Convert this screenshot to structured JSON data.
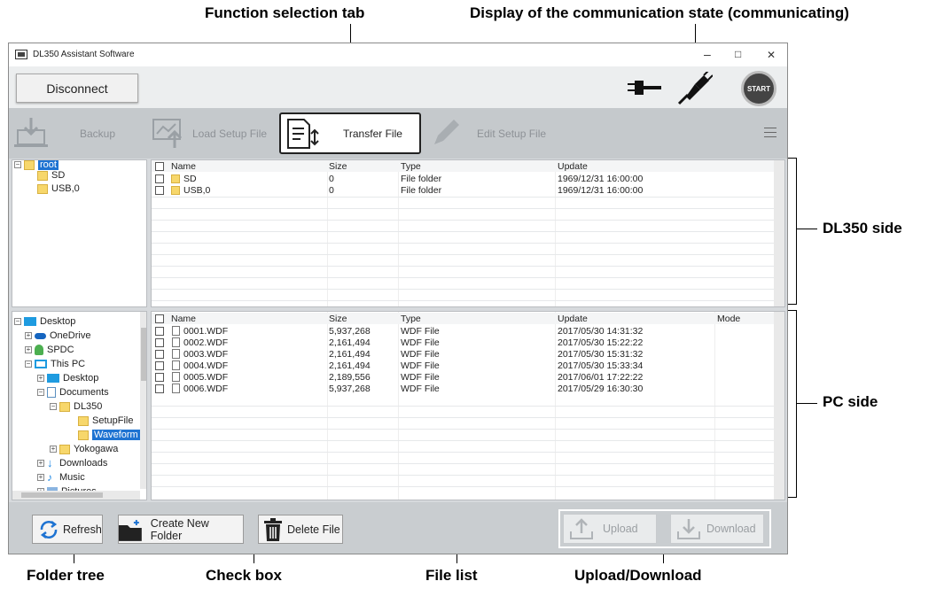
{
  "callouts": {
    "function_tab": "Function selection tab",
    "comm_state": "Display of the communication state (communicating)",
    "dl350_side": "DL350 side",
    "pc_side": "PC side",
    "folder_tree": "Folder tree",
    "check_box": "Check box",
    "file_list": "File list",
    "upload_download": "Upload/Download"
  },
  "window": {
    "title": "DL350 Assistant Software",
    "minimize": "–",
    "maximize": "□",
    "close": "✕"
  },
  "toolbar": {
    "disconnect_label": "Disconnect",
    "start_label": "START"
  },
  "tabs": [
    {
      "label": "Backup",
      "icon": "backup-icon"
    },
    {
      "label": "Load Setup File",
      "icon": "load-setup-icon"
    },
    {
      "label": "Transfer File",
      "icon": "transfer-file-icon"
    },
    {
      "label": "Edit Setup File",
      "icon": "pencil-icon"
    }
  ],
  "dl350_tree": {
    "root": "root",
    "children": [
      "SD",
      "USB,0"
    ]
  },
  "pc_tree": [
    {
      "label": "Desktop",
      "pm": "−"
    },
    {
      "label": "OneDrive",
      "pm": "+"
    },
    {
      "label": "SPDC",
      "pm": "+"
    },
    {
      "label": "This PC",
      "pm": "−"
    },
    {
      "label": "Desktop",
      "pm": "+"
    },
    {
      "label": "Documents",
      "pm": "−"
    },
    {
      "label": "DL350",
      "pm": "−"
    },
    {
      "label": "SetupFile",
      "pm": ""
    },
    {
      "label": "Waveform",
      "pm": ""
    },
    {
      "label": "Yokogawa",
      "pm": "+"
    },
    {
      "label": "Downloads",
      "pm": "+"
    },
    {
      "label": "Music",
      "pm": "+"
    },
    {
      "label": "Pictures",
      "pm": "+"
    }
  ],
  "dl350_list": {
    "headers": {
      "name": "Name",
      "size": "Size",
      "type": "Type",
      "update": "Update"
    },
    "rows": [
      {
        "name": "SD",
        "size": "0",
        "type": "File folder",
        "update": "1969/12/31 16:00:00"
      },
      {
        "name": "USB,0",
        "size": "0",
        "type": "File folder",
        "update": "1969/12/31 16:00:00"
      }
    ]
  },
  "pc_list": {
    "headers": {
      "name": "Name",
      "size": "Size",
      "type": "Type",
      "update": "Update",
      "mode": "Mode"
    },
    "rows": [
      {
        "name": "0001.WDF",
        "size": "5,937,268",
        "type": "WDF File",
        "update": "2017/05/30 14:31:32"
      },
      {
        "name": "0002.WDF",
        "size": "2,161,494",
        "type": "WDF File",
        "update": "2017/05/30 15:22:22"
      },
      {
        "name": "0003.WDF",
        "size": "2,161,494",
        "type": "WDF File",
        "update": "2017/05/30 15:31:32"
      },
      {
        "name": "0004.WDF",
        "size": "2,161,494",
        "type": "WDF File",
        "update": "2017/05/30 15:33:34"
      },
      {
        "name": "0005.WDF",
        "size": "2,189,556",
        "type": "WDF File",
        "update": "2017/06/01 17:22:22"
      },
      {
        "name": "0006.WDF",
        "size": "5,937,268",
        "type": "WDF File",
        "update": "2017/05/29 16:30:30"
      }
    ]
  },
  "bottom": {
    "refresh": "Refresh",
    "create_folder": "Create New Folder",
    "delete_file": "Delete File",
    "upload": "Upload",
    "download": "Download"
  },
  "colors": {
    "selection": "#1e73d2",
    "folder": "#f7d76b",
    "window_bg": "#d7dadd"
  }
}
